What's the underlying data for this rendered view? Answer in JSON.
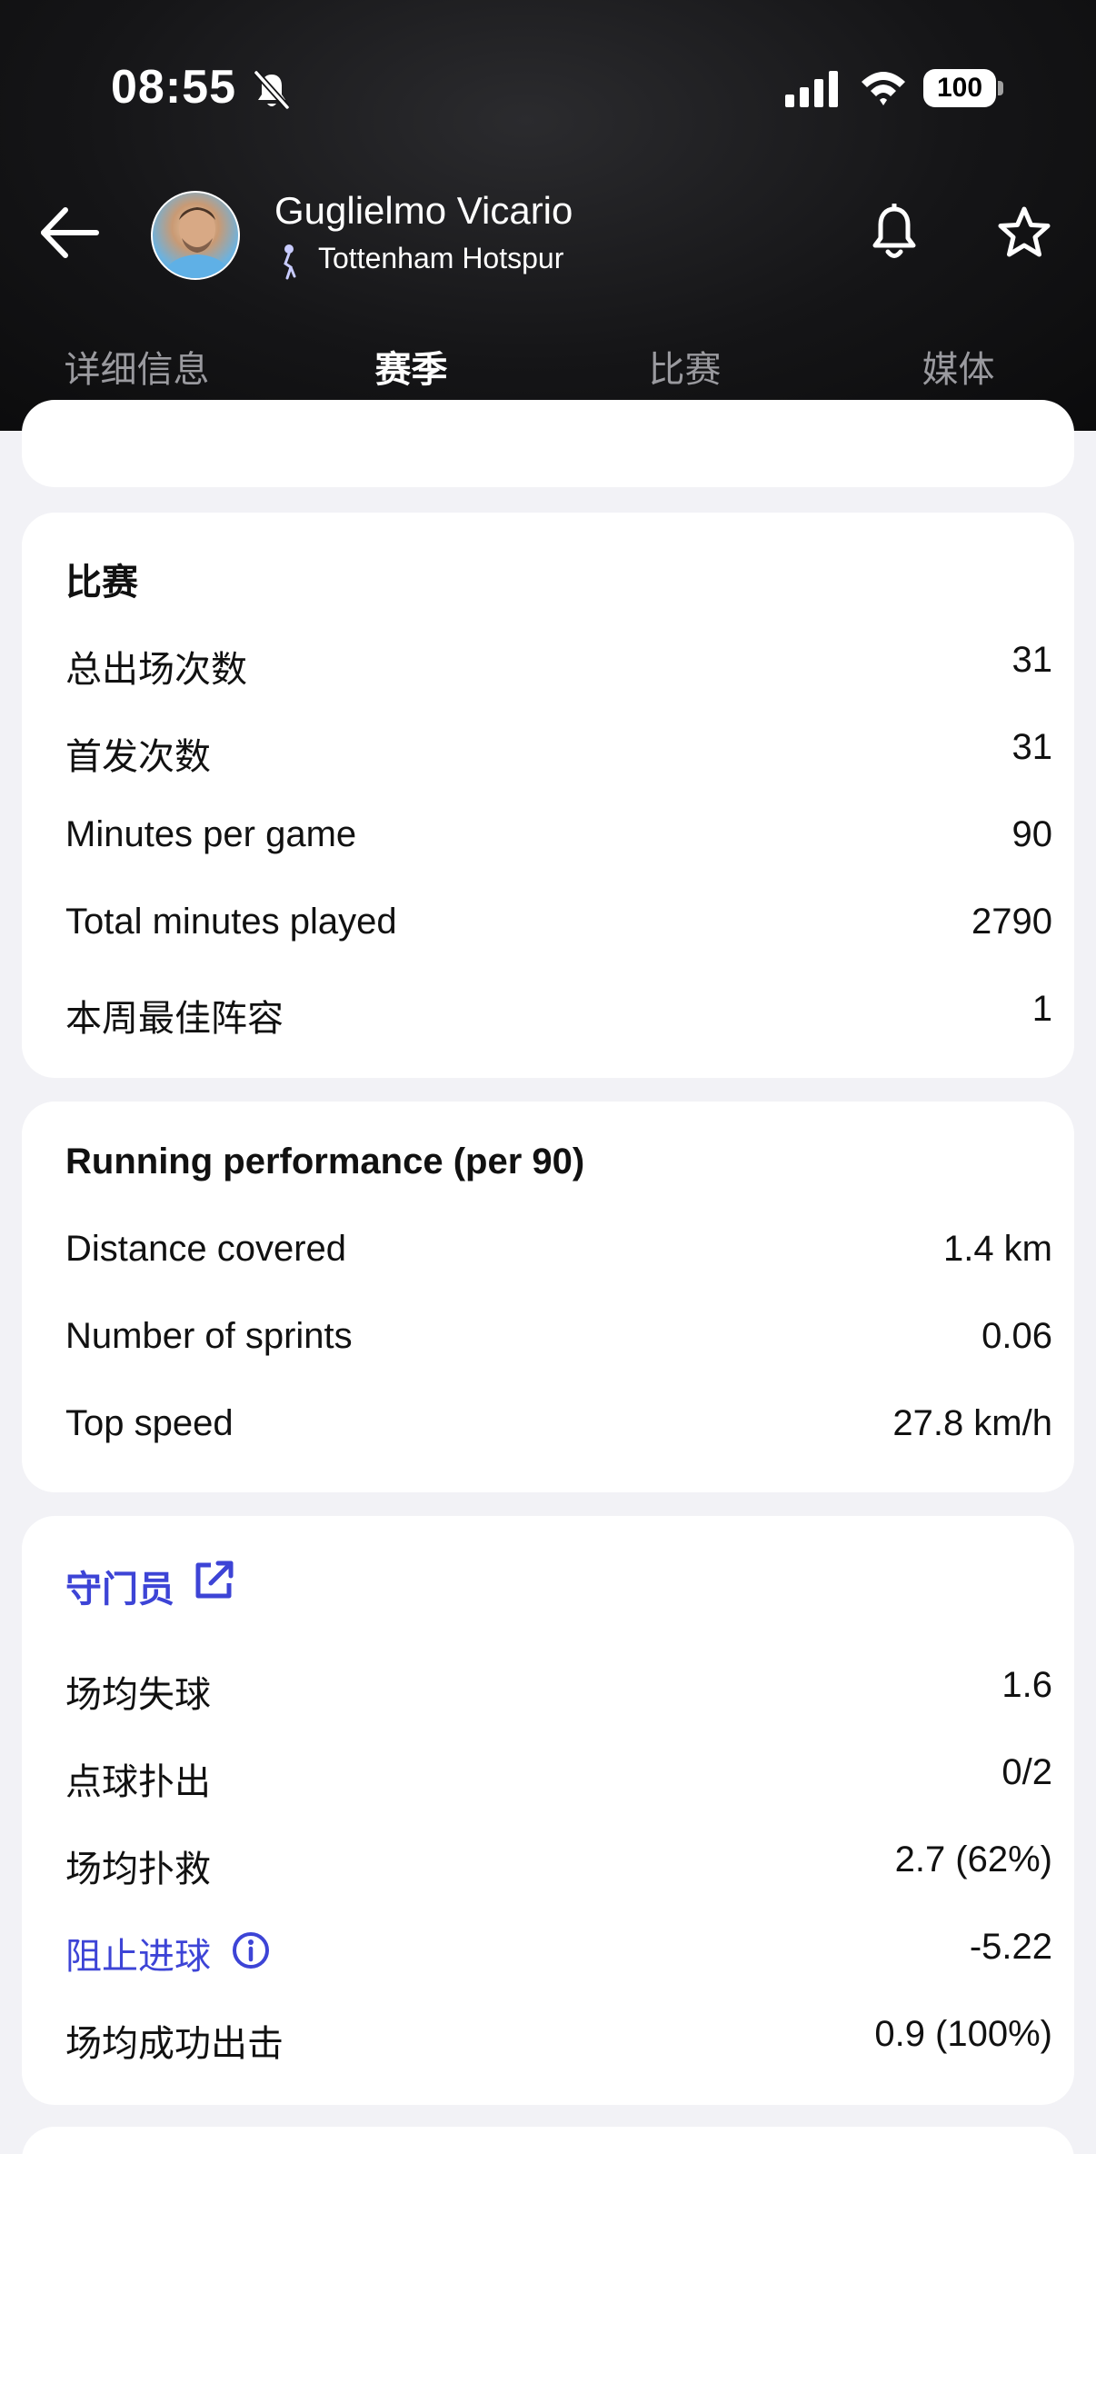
{
  "status_bar": {
    "time": "08:55",
    "battery": "100",
    "icons": [
      "bell-slash-icon",
      "signal-icon",
      "wifi-icon",
      "battery-icon"
    ]
  },
  "header": {
    "player_name": "Guglielmo Vicario",
    "club_name": "Tottenham Hotspur",
    "icons": [
      "back-arrow-icon",
      "club-crest-icon",
      "bell-icon",
      "star-icon"
    ]
  },
  "tabs": [
    {
      "label": "详细信息",
      "active": false
    },
    {
      "label": "赛季",
      "active": true
    },
    {
      "label": "比赛",
      "active": false
    },
    {
      "label": "媒体",
      "active": false
    }
  ],
  "matches_card": {
    "title": "比赛",
    "rows": [
      {
        "label": "总出场次数",
        "value": "31"
      },
      {
        "label": "首发次数",
        "value": "31"
      },
      {
        "label": "Minutes per game",
        "value": "90"
      },
      {
        "label": "Total minutes played",
        "value": "2790"
      },
      {
        "label": "本周最佳阵容",
        "value": "1"
      }
    ]
  },
  "running_card": {
    "title": "Running performance (per 90)",
    "rows": [
      {
        "label": "Distance covered",
        "value": "1.4 km"
      },
      {
        "label": "Number of sprints",
        "value": "0.06"
      },
      {
        "label": "Top speed",
        "value": "27.8 km/h"
      }
    ]
  },
  "goalkeeper_card": {
    "title": "守门员",
    "rows": [
      {
        "label": "场均失球",
        "value": "1.6"
      },
      {
        "label": "点球扑出",
        "value": "0/2"
      },
      {
        "label": "场均扑救",
        "value": "2.7 (62%)"
      },
      {
        "label": "阻止进球",
        "value": "-5.22"
      },
      {
        "label": "场均成功出击",
        "value": "0.9 (100%)"
      }
    ]
  },
  "colors": {
    "accent": "#3d44d6",
    "header_bg": "#111113",
    "page_bg": "#f2f2f6",
    "card_bg": "#ffffff"
  }
}
